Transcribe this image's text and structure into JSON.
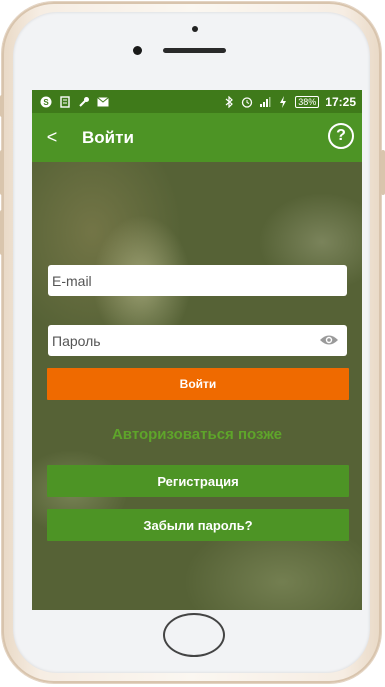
{
  "status_bar": {
    "icons_left": [
      "skype-icon",
      "document-icon",
      "wrench-icon",
      "mail-icon"
    ],
    "icons_right": [
      "bluetooth-icon",
      "alarm-icon",
      "signal-icon",
      "charging-icon"
    ],
    "battery": "38%",
    "time": "17:25"
  },
  "app_bar": {
    "back_symbol": "<",
    "title": "Войти",
    "help_symbol": "?"
  },
  "form": {
    "email_placeholder": "E-mail",
    "password_placeholder": "Пароль",
    "login_button": "Войти",
    "later_link": "Авторизоваться позже",
    "register_button": "Регистрация",
    "forgot_button": "Забыли пароль?"
  },
  "colors": {
    "status_bar": "#3f7a1a",
    "app_bar": "#4d9425",
    "login_button": "#ef6a00",
    "green_button": "#4d9425",
    "link": "#5ea52a"
  }
}
